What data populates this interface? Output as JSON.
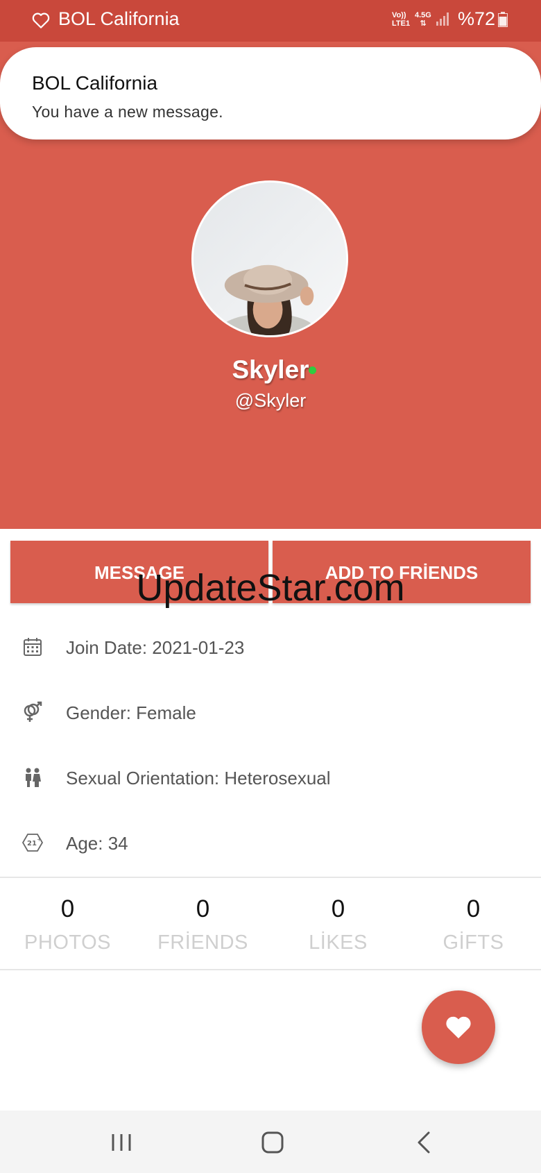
{
  "status_bar": {
    "app_name": "BOL California",
    "network_line1": "Vo))",
    "network_line2": "LTE1",
    "network_type": "4.5G",
    "battery": "%72",
    "icons": [
      "heart-outline-icon",
      "signal-icon",
      "battery-icon"
    ]
  },
  "notification": {
    "title": "BOL California",
    "body": "You have a new message."
  },
  "profile": {
    "name": "Skyler",
    "username": "@Skyler",
    "online": true,
    "online_color": "#2ecc40"
  },
  "actions": {
    "message_label": "MESSAGE",
    "add_friend_label": "ADD TO FRİENDS"
  },
  "watermark": "UpdateStar.com",
  "info": [
    {
      "icon": "calendar-icon",
      "text": "Join Date: 2021-01-23"
    },
    {
      "icon": "gender-icon",
      "text": "Gender: Female"
    },
    {
      "icon": "couple-icon",
      "text": "Sexual Orientation: Heterosexual"
    },
    {
      "icon": "age-21-icon",
      "text": "Age: 34"
    }
  ],
  "stats": [
    {
      "value": "0",
      "label": "PHOTOS"
    },
    {
      "value": "0",
      "label": "FRİENDS"
    },
    {
      "value": "0",
      "label": "LİKES"
    },
    {
      "value": "0",
      "label": "GİFTS"
    }
  ],
  "colors": {
    "status_bar": "#c9483b",
    "accent": "#d95d4e",
    "text_muted": "#555555",
    "stat_label": "#cfcfcf"
  },
  "fab_icon": "heart-icon",
  "nav": [
    "recents-icon",
    "home-icon",
    "back-icon"
  ]
}
